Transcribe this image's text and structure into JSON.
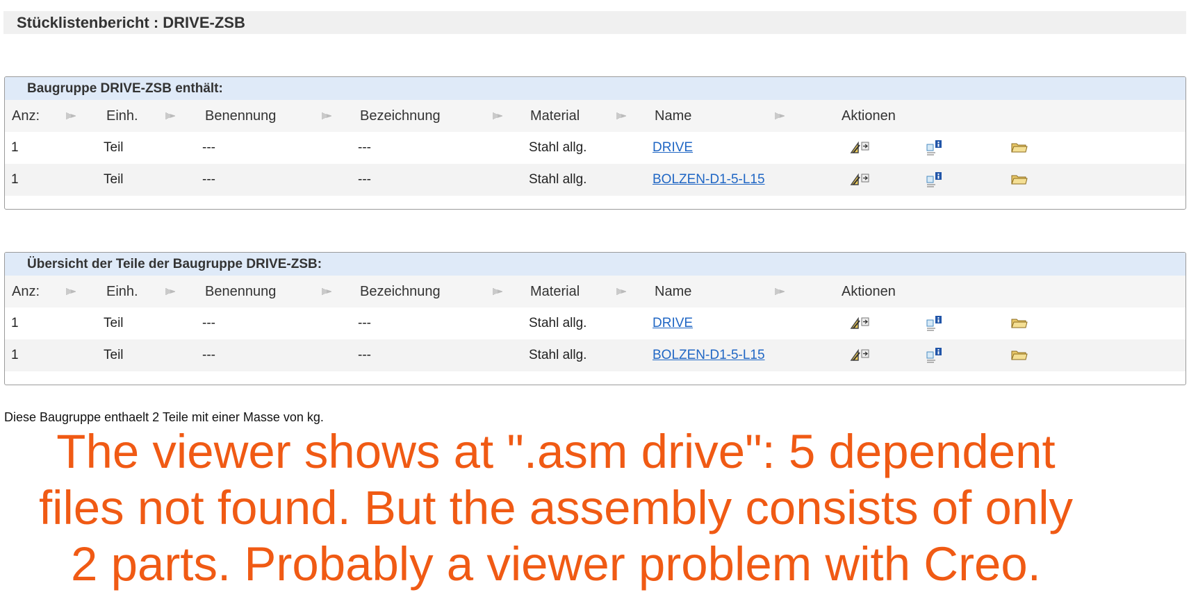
{
  "page": {
    "title": "Stücklistenbericht : DRIVE-ZSB"
  },
  "panels": [
    {
      "header": "Baugruppe DRIVE-ZSB enthält:",
      "columns": [
        "Anz:",
        "Einh.",
        "Benennung",
        "Bezeichnung",
        "Material",
        "Name",
        "Aktionen"
      ],
      "rows": [
        {
          "anz": "1",
          "einh": "Teil",
          "benennung": "---",
          "bezeichnung": "---",
          "material": "Stahl allg.",
          "name": "DRIVE"
        },
        {
          "anz": "1",
          "einh": "Teil",
          "benennung": "---",
          "bezeichnung": "---",
          "material": "Stahl allg.",
          "name": "BOLZEN-D1-5-L15"
        }
      ]
    },
    {
      "header": "Übersicht der Teile der Baugruppe DRIVE-ZSB:",
      "columns": [
        "Anz:",
        "Einh.",
        "Benennung",
        "Bezeichnung",
        "Material",
        "Name",
        "Aktionen"
      ],
      "rows": [
        {
          "anz": "1",
          "einh": "Teil",
          "benennung": "---",
          "bezeichnung": "---",
          "material": "Stahl allg.",
          "name": "DRIVE"
        },
        {
          "anz": "1",
          "einh": "Teil",
          "benennung": "---",
          "bezeichnung": "---",
          "material": "Stahl allg.",
          "name": "BOLZEN-D1-5-L15"
        }
      ]
    }
  ],
  "summary": "Diese Baugruppe enthaelt 2 Teile mit einer Masse von kg.",
  "annotation": {
    "lines": [
      "The viewer shows at \".asm drive\": 5 dependent",
      "files not found. But the assembly consists of only",
      "2 parts. Probably a viewer problem with Creo."
    ],
    "color": "#f05a14"
  },
  "icons": {
    "sort": "sort-icon",
    "actions": [
      "drawing-edit-icon",
      "properties-info-icon",
      "open-folder-icon"
    ]
  },
  "colors": {
    "link": "#1f66c4",
    "panel_header_bg": "#dfeaf8"
  }
}
